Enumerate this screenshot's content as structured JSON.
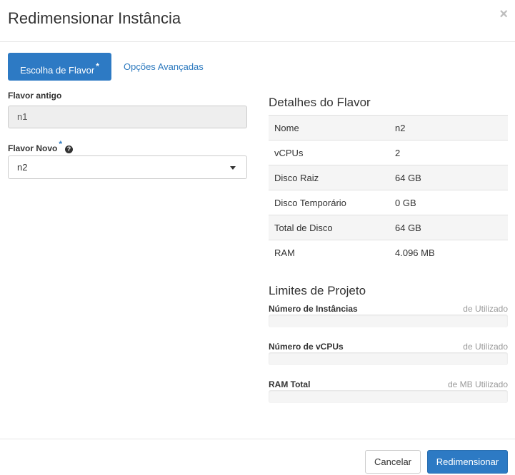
{
  "header": {
    "title": "Redimensionar Instância",
    "close_icon": "×"
  },
  "tabs": [
    {
      "label": "Escolha de Flavor",
      "required_mark": "*",
      "active": true
    },
    {
      "label": "Opções Avançadas",
      "active": false
    }
  ],
  "form": {
    "old_flavor_label": "Flavor antigo",
    "old_flavor_value": "n1",
    "new_flavor_label": "Flavor Novo",
    "new_flavor_required_mark": "*",
    "help_icon": "?",
    "new_flavor_selected": "n2"
  },
  "flavor_details": {
    "title": "Detalhes do Flavor",
    "rows": [
      {
        "name": "Nome",
        "value": "n2"
      },
      {
        "name": "vCPUs",
        "value": "2"
      },
      {
        "name": "Disco Raiz",
        "value": "64 GB"
      },
      {
        "name": "Disco Temporário",
        "value": "0 GB"
      },
      {
        "name": "Total de Disco",
        "value": "64 GB"
      },
      {
        "name": "RAM",
        "value": "4.096 MB"
      }
    ]
  },
  "project_limits": {
    "title": "Limites de Projeto",
    "items": [
      {
        "label": "Número de Instâncias",
        "used": "de Utilizado",
        "fill": 0
      },
      {
        "label": "Número de vCPUs",
        "used": "de Utilizado",
        "fill": 0
      },
      {
        "label": "RAM Total",
        "used": "de MB Utilizado",
        "fill": 0
      }
    ]
  },
  "footer": {
    "cancel_label": "Cancelar",
    "submit_label": "Redimensionar"
  },
  "colors": {
    "primary": "#2d7ac4",
    "link": "#2f7bbf"
  }
}
